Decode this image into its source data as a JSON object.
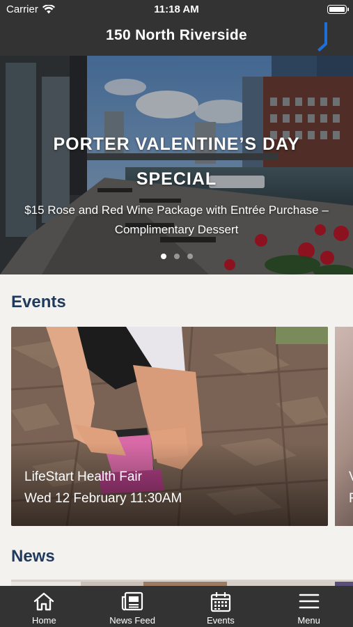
{
  "status_bar": {
    "carrier": "Carrier",
    "time": "11:18 AM"
  },
  "header": {
    "title": "150 North Riverside",
    "logo_color": "#1e6fd9"
  },
  "hero": {
    "title": "PORTER VALENTINE’S DAY SPECIAL",
    "subtitle": "$15 Rose and Red Wine Package with Entrée Purchase – Complimentary Dessert",
    "slides_total": 3,
    "active_slide": 1
  },
  "events": {
    "heading": "Events",
    "cards": [
      {
        "name": "LifeStart Health Fair",
        "date": "Wed 12 February 11:30AM"
      }
    ],
    "next_card_name_initial": "V",
    "next_card_date_initial": "F"
  },
  "news": {
    "heading": "News"
  },
  "tabs": [
    {
      "label": "Home",
      "icon": "home-icon"
    },
    {
      "label": "News Feed",
      "icon": "newspaper-icon"
    },
    {
      "label": "Events",
      "icon": "calendar-icon"
    },
    {
      "label": "Menu",
      "icon": "hamburger-menu-icon"
    }
  ],
  "colors": {
    "bars": "#333333",
    "heading": "#1f3a5c",
    "background": "#f4f2ef"
  }
}
